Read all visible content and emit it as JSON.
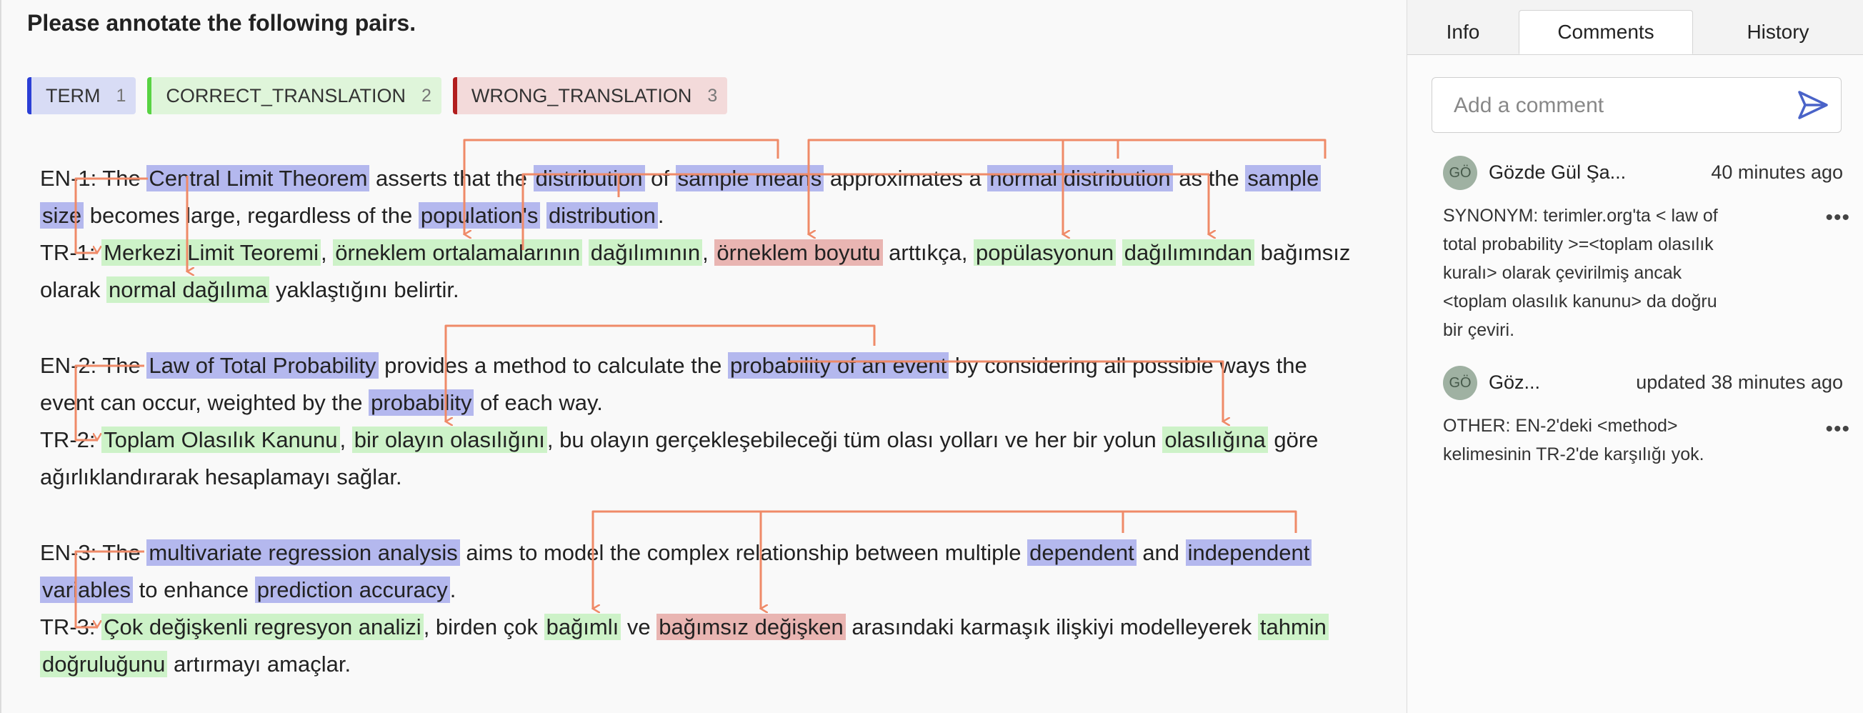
{
  "task": {
    "title": "Please annotate the following pairs."
  },
  "labels": [
    {
      "name": "TERM",
      "key": "1",
      "color": "#2b3fd6"
    },
    {
      "name": "CORRECT_TRANSLATION",
      "key": "2",
      "color": "#58d343"
    },
    {
      "name": "WRONG_TRANSLATION",
      "key": "3",
      "color": "#b21e1e"
    }
  ],
  "relation_color": "#ef8a68",
  "pairs": [
    {
      "en": {
        "p1": "EN-1: The ",
        "s1": "Central Limit Theorem",
        "p2": " asserts that the ",
        "s2": "distribution",
        "p3": " of ",
        "s3": "sample means",
        "p4": " approximates a ",
        "s4": "normal distribution",
        "p5": " as the ",
        "s5": "sample",
        "s5b": "size",
        "p6": " becomes large, regardless of the ",
        "s6": "population's",
        "p7": " ",
        "s7": "distribution",
        "p8": "."
      },
      "tr": {
        "p1": "TR-1: ",
        "s1": "Merkezi Limit Teoremi",
        "p2": ", ",
        "s2": "örneklem ortalamalarının",
        "p3": " ",
        "s3": "dağılımının",
        "p4": ", ",
        "s4": "örneklem boyutu",
        "p5": " arttıkça, ",
        "s5": "popülasyonun",
        "p6": " ",
        "s6": "dağılımından",
        "p7": " bağımsız",
        "p8": "olarak ",
        "s7": "normal dağılıma",
        "p9": " yaklaştığını belirtir."
      }
    },
    {
      "en": {
        "p1": "EN-2: The ",
        "s1": "Law of Total Probability",
        "p2": " provides a method to calculate the ",
        "s2": "probability of an event",
        "p3": " by considering all possible ways the",
        "p4": "event can occur, weighted by the ",
        "s3": "probability",
        "p5": " of each way."
      },
      "tr": {
        "p1": "TR-2: ",
        "s1": "Toplam Olasılık Kanunu",
        "p2": ", ",
        "s2": "bir olayın olasılığını",
        "p3": ", bu olayın gerçekleşebileceği tüm olası yolları ve her bir yolun ",
        "s3": "olasılığına",
        "p4": " göre",
        "p5": "ağırlıklandırarak hesaplamayı sağlar."
      }
    },
    {
      "en": {
        "p1": "EN-3: The ",
        "s1": "multivariate regression analysis",
        "p2": " aims to model the complex relationship between multiple ",
        "s2": "dependent",
        "p3": " and ",
        "s3": "independent",
        "s3b": "variables",
        "p4": " to enhance ",
        "s4": "prediction accuracy",
        "p5": "."
      },
      "tr": {
        "p1": "TR-3: ",
        "s1": "Çok değişkenli regresyon analizi",
        "p2": ", birden çok ",
        "s2": "bağımlı",
        "p3": " ve ",
        "s3": "bağımsız değişken",
        "p4": " arasındaki karmaşık ilişkiyi modelleyerek ",
        "s4": "tahmin",
        "s4b": "doğruluğunu",
        "p5": " artırmayı amaçlar."
      }
    }
  ],
  "panel": {
    "tabs": [
      {
        "label": "Info",
        "active": false
      },
      {
        "label": "Comments",
        "active": true
      },
      {
        "label": "History",
        "active": false
      }
    ],
    "comment_placeholder": "Add a comment",
    "comments": [
      {
        "avatar": "GÖ",
        "author": "Gözde Gül Şa...",
        "time": "40 minutes ago",
        "text": "SYNONYM: terimler.org'ta < law of\ntotal probability >=<toplam olasılık\nkuralı> olarak çevirilmiş ancak\n<toplam olasılık kanunu> da doğru\nbir çeviri."
      },
      {
        "avatar": "GÖ",
        "author": "Göz...",
        "time": "updated 38 minutes ago",
        "text": "OTHER: EN-2'deki <method>\nkelimesinin TR-2'de karşılığı yok."
      }
    ]
  }
}
